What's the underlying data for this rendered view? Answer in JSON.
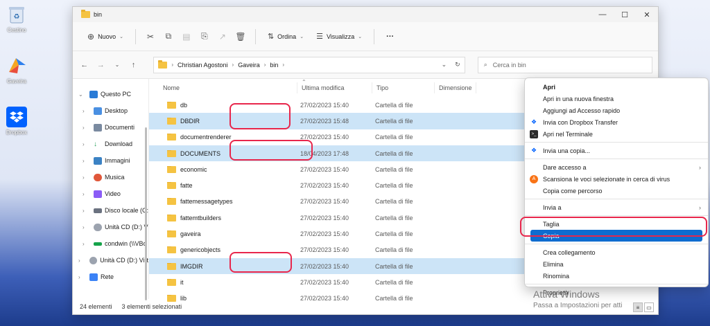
{
  "desktop": {
    "icons": [
      {
        "label": "Cestino"
      },
      {
        "label": "Gaveira"
      },
      {
        "label": "Dropbox"
      }
    ]
  },
  "window": {
    "tab_title": "bin",
    "controls": {
      "minimize": "—",
      "maximize": "☐",
      "close": "✕"
    }
  },
  "toolbar": {
    "new_label": "Nuovo",
    "sort_label": "Ordina",
    "view_label": "Visualizza",
    "more_label": "···"
  },
  "address": {
    "path": [
      "Christian Agostoni",
      "Gaveira",
      "bin"
    ],
    "search_placeholder": "Cerca in bin"
  },
  "sidebar": {
    "items": [
      {
        "label": "Questo PC",
        "color": "#2a7bd6"
      },
      {
        "label": "Desktop",
        "color": "#4a90e2"
      },
      {
        "label": "Documenti",
        "color": "#7a8aa0"
      },
      {
        "label": "Download",
        "color": "#1f9d55"
      },
      {
        "label": "Immagini",
        "color": "#3b82c4"
      },
      {
        "label": "Musica",
        "color": "#e0573a"
      },
      {
        "label": "Video",
        "color": "#8b5cf6"
      },
      {
        "label": "Disco locale (C:",
        "color": "#6b7280"
      },
      {
        "label": "Unità CD (D:) V",
        "color": "#9ca3af"
      },
      {
        "label": "condwin (\\\\VBc",
        "color": "#16a34a"
      },
      {
        "label": "Unità CD (D:) Virt",
        "color": "#9ca3af"
      },
      {
        "label": "Rete",
        "color": "#3b82f6"
      }
    ]
  },
  "columns": {
    "name": "Nome",
    "modified": "Ultima modifica",
    "type": "Tipo",
    "size": "Dimensione"
  },
  "files": [
    {
      "name": "db",
      "date": "27/02/2023 15:40",
      "type": "Cartella di file"
    },
    {
      "name": "DBDIR",
      "date": "27/02/2023 15:48",
      "type": "Cartella di file"
    },
    {
      "name": "documentrenderer",
      "date": "27/02/2023 15:40",
      "type": "Cartella di file"
    },
    {
      "name": "DOCUMENTS",
      "date": "18/04/2023 17:48",
      "type": "Cartella di file"
    },
    {
      "name": "economic",
      "date": "27/02/2023 15:40",
      "type": "Cartella di file"
    },
    {
      "name": "fatte",
      "date": "27/02/2023 15:40",
      "type": "Cartella di file"
    },
    {
      "name": "fattemessagetypes",
      "date": "27/02/2023 15:40",
      "type": "Cartella di file"
    },
    {
      "name": "fattemtbuilders",
      "date": "27/02/2023 15:40",
      "type": "Cartella di file"
    },
    {
      "name": "gaveira",
      "date": "27/02/2023 15:40",
      "type": "Cartella di file"
    },
    {
      "name": "genericobjects",
      "date": "27/02/2023 15:40",
      "type": "Cartella di file"
    },
    {
      "name": "IMGDIR",
      "date": "27/02/2023 15:40",
      "type": "Cartella di file"
    },
    {
      "name": "it",
      "date": "27/02/2023 15:40",
      "type": "Cartella di file"
    },
    {
      "name": "lib",
      "date": "27/02/2023 15:40",
      "type": "Cartella di file"
    }
  ],
  "status": {
    "count": "24 elementi",
    "selected": "3 elementi selezionati"
  },
  "context_menu": {
    "items": [
      {
        "label": "Apri"
      },
      {
        "label": "Apri in una nuova finestra"
      },
      {
        "label": "Aggiungi ad Accesso rapido"
      },
      {
        "label": "Invia con Dropbox Transfer"
      },
      {
        "label": "Apri nel Terminale"
      },
      {
        "label": "Invia una copia..."
      },
      {
        "label": "Dare accesso a"
      },
      {
        "label": "Scansiona le voci selezionate in cerca di virus"
      },
      {
        "label": "Copia come percorso"
      },
      {
        "label": "Invia a"
      },
      {
        "label": "Taglia"
      },
      {
        "label": "Copia"
      },
      {
        "label": "Crea collegamento"
      },
      {
        "label": "Elimina"
      },
      {
        "label": "Rinomina"
      },
      {
        "label": "Proprietà"
      }
    ]
  },
  "watermark": {
    "title": "Attiva Windows",
    "subtitle": "Passa a Impostazioni per atti"
  }
}
